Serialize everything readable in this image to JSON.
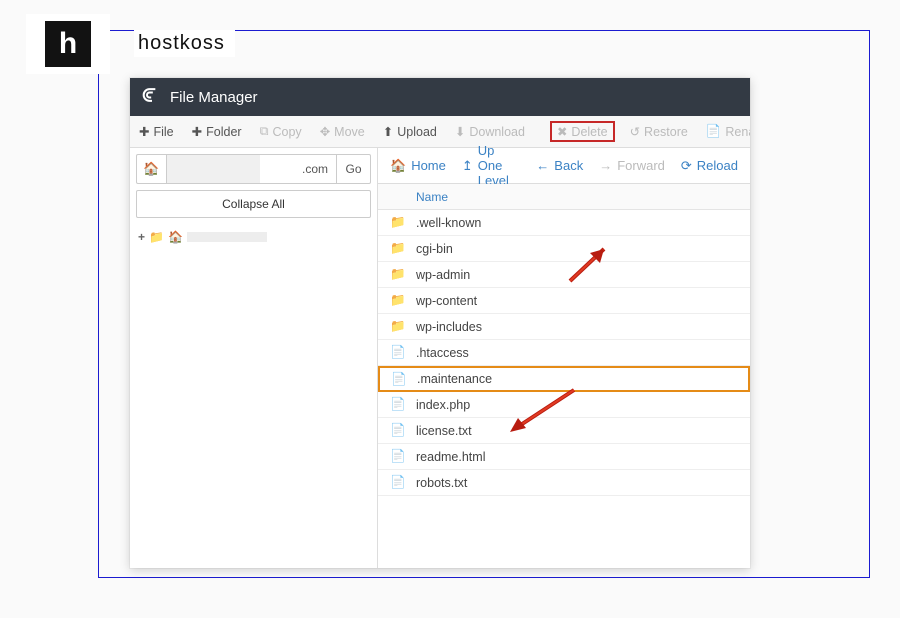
{
  "brand": {
    "logo_letter": "h",
    "name": "hostkoss"
  },
  "window": {
    "title": "File Manager"
  },
  "toolbar": {
    "file": "File",
    "folder": "Folder",
    "copy": "Copy",
    "move": "Move",
    "upload": "Upload",
    "download": "Download",
    "delete": "Delete",
    "restore": "Restore",
    "rename": "Rename"
  },
  "address": {
    "domain_suffix": ".com",
    "go": "Go"
  },
  "collapse_label": "Collapse All",
  "nav": {
    "home": "Home",
    "up": "Up One Level",
    "back": "Back",
    "forward": "Forward",
    "reload": "Reload"
  },
  "list_header": {
    "name": "Name"
  },
  "files": [
    {
      "name": ".well-known",
      "type": "folder"
    },
    {
      "name": "cgi-bin",
      "type": "folder"
    },
    {
      "name": "wp-admin",
      "type": "folder"
    },
    {
      "name": "wp-content",
      "type": "folder"
    },
    {
      "name": "wp-includes",
      "type": "folder"
    },
    {
      "name": ".htaccess",
      "type": "doc"
    },
    {
      "name": ".maintenance",
      "type": "doc",
      "highlight": true
    },
    {
      "name": "index.php",
      "type": "code"
    },
    {
      "name": "license.txt",
      "type": "code"
    },
    {
      "name": "readme.html",
      "type": "code"
    },
    {
      "name": "robots.txt",
      "type": "doc"
    }
  ]
}
